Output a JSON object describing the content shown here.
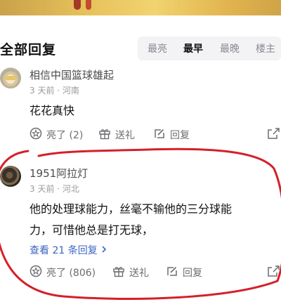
{
  "header": {
    "title": "全部回复",
    "sort_tabs": [
      "最亮",
      "最早",
      "最晚",
      "楼主"
    ],
    "active_tab": "最早"
  },
  "comments": [
    {
      "username": "相信中国篮球雄起",
      "meta": "3 天前 · 河南",
      "text_lines": [
        "花花真快"
      ],
      "actions": {
        "like": "亮了 (2)",
        "gift": "送礼",
        "reply": "回复"
      }
    },
    {
      "username": "1951阿拉灯",
      "meta": "3 天前 · 河北",
      "text_lines": [
        "他的处理球能力，丝毫不输他的三分球能",
        "力，可惜他总是打无球，"
      ],
      "replies_link": "查看 21 条回复",
      "actions": {
        "like": "亮了 (806)",
        "gift": "送礼",
        "reply": "回复"
      }
    }
  ],
  "colors": {
    "link": "#3a66c4",
    "annotation": "#d4202a",
    "sort_bg": "#f3f3f5"
  },
  "icons": [
    "like-icon",
    "gift-icon",
    "reply-icon",
    "share-icon",
    "chevron-right-icon"
  ]
}
